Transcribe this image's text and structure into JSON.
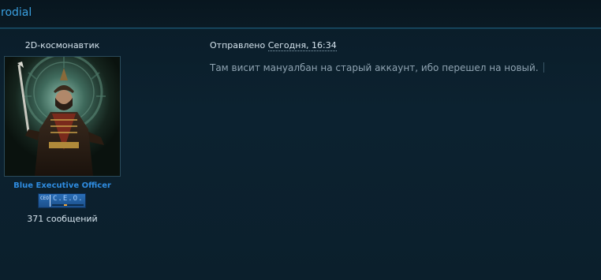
{
  "post": {
    "author": "rodial",
    "user_title": "2D-космонавтик",
    "group": "Blue Executive Officer",
    "rank_badge": {
      "small_text": "CEO",
      "big_text": "C.E.O."
    },
    "post_count": "371 сообщений",
    "meta_prefix": "Отправлено",
    "date": "Сегодня, 16:34",
    "body": "Там висит мануалбан на старый аккаунт, ибо перешел на новый."
  },
  "colors": {
    "background": "#0b1e2a",
    "author_link": "#3aa0e0",
    "group_link": "#2f8ce0",
    "body_text": "#8fa3b1",
    "rank_badge": "#2a6fb8"
  },
  "icons": {
    "avatar": "armored-warrior-avatar"
  }
}
